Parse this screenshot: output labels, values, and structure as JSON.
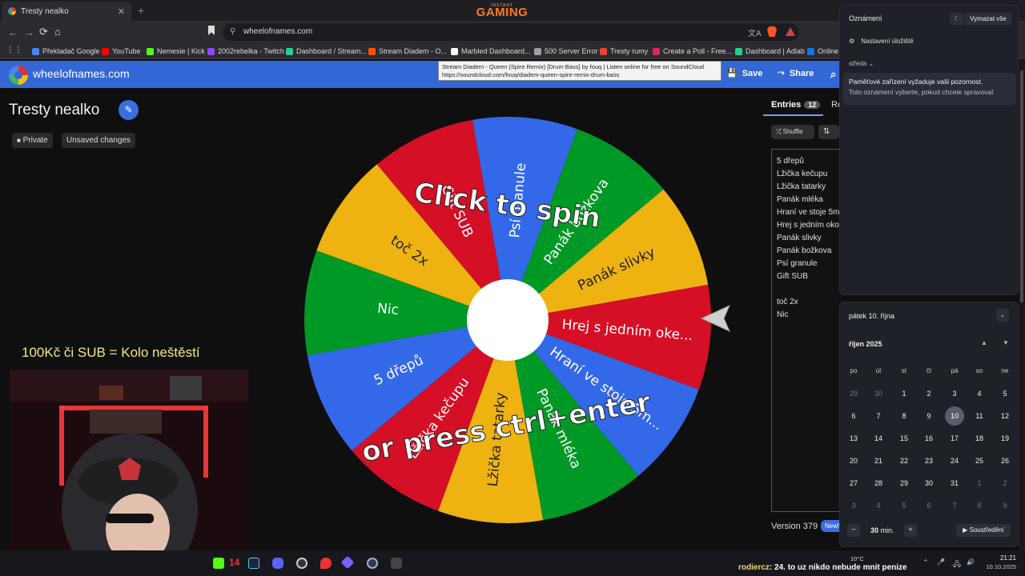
{
  "browser": {
    "active_tab": "Tresty nealko",
    "close_glyph": "✕",
    "new_tab_glyph": "+",
    "brand_small": "INSTANT",
    "brand_big": "GAMING",
    "url": "wheelofnames.com",
    "nav": {
      "back": "←",
      "forward": "→",
      "reload": "⟳",
      "home": "⌂",
      "apps": "⋮⋮"
    },
    "translate_glyph": "文A",
    "bookmarks": [
      {
        "label": "Překladač Google",
        "color": "#4285f4"
      },
      {
        "label": "YouTube",
        "color": "#ff0000"
      },
      {
        "label": "Nemesie | Kick",
        "color": "#53fc18"
      },
      {
        "label": "2002rebelka - Twitch",
        "color": "#9146ff"
      },
      {
        "label": "Dashboard / Stream...",
        "color": "#23d18b"
      },
      {
        "label": "Stream Diadem - O...",
        "color": "#ff5500"
      },
      {
        "label": "Marbled Dashboard...",
        "color": "#ffffff"
      },
      {
        "label": "500 Server Error",
        "color": "#9aa0a6"
      },
      {
        "label": "Tresty rumy",
        "color": "#ea4335"
      },
      {
        "label": "Create a Poll - Free...",
        "color": "#e0245e"
      },
      {
        "label": "Dashboard | Adlab",
        "color": "#23d18b"
      },
      {
        "label": "Online",
        "color": "#1a73e8"
      }
    ],
    "tooltip_line1": "Stream Diadem - Queen (Spire Remix) [Drum Bass] by fouq | Listen online for free on SoundCloud",
    "tooltip_line2": "https://soundcloud.com/fouq/diadem-queen-spire-remix-drum-bass"
  },
  "app": {
    "site_name": "wheelofnames.com",
    "save_label": "Save",
    "share_label": "Share",
    "save_icon": "💾",
    "share_icon": "⤳",
    "search_icon": "⌕",
    "wheel_title": "Tresty nealko",
    "edit_icon": "✎",
    "private_label": "Private",
    "lock_icon": "🔒",
    "unsaved_label": "Unsaved changes",
    "overlay_text": "100Kč či SUB = Kolo neštěstí",
    "entries_tab": "Entries",
    "entries_count": "12",
    "results_tab": "Re",
    "shuffle_label": "Shuffle",
    "shuffle_icon": "⤮",
    "sort_icon": "⇅",
    "entries": [
      "5 dřepů",
      "Lžička kečupu",
      "Lžička tatarky",
      "Panák mléka",
      "Hraní ve stoje 5m",
      "Hrej s jedním oko",
      "Panák slivky",
      "Panák božkova",
      "Psí granule",
      "Gift SUB",
      "",
      "toč 2x",
      "Nic"
    ],
    "version": "Version 379",
    "new_badge": "New!"
  },
  "wheel": {
    "spin_text_top": "Click to spin",
    "spin_text_bottom": "or press ctrl+enter",
    "segments": [
      {
        "label": "Psí granule",
        "color": "#3369e8"
      },
      {
        "label": "Panák božkova",
        "color": "#009925"
      },
      {
        "label": "Panák slivky",
        "color": "#eeb211"
      },
      {
        "label": "Hrej s jedním oke...",
        "color": "#d50f25"
      },
      {
        "label": "Hraní ve stoje 5m...",
        "color": "#3369e8"
      },
      {
        "label": "Panák mléka",
        "color": "#009925"
      },
      {
        "label": "Lžička tatarky",
        "color": "#eeb211"
      },
      {
        "label": "Lžička kečupu",
        "color": "#d50f25"
      },
      {
        "label": "5 dřepů",
        "color": "#3369e8"
      },
      {
        "label": "Nic",
        "color": "#009925"
      },
      {
        "label": "toč 2x",
        "color": "#eeb211"
      },
      {
        "label": "Gift SUB",
        "color": "#d50f25"
      }
    ]
  },
  "notifications": {
    "title": "Oznámení",
    "clear_all": "Vymazat vše",
    "settings_icon": "⚙",
    "focus_icon": "☾",
    "storage_settings": "Nastavení úložiště",
    "day": "středa",
    "chevron": "⌄",
    "message_title": "Paměťové zařízení vyžaduje vaši pozornost.",
    "message_body": "Toto oznámení vyberte, pokud chcete spravovat"
  },
  "calendar": {
    "date_label": "pátek 10. října",
    "collapse_icon": "⌄",
    "month_label": "říjen 2025",
    "up_icon": "▲",
    "down_icon": "▼",
    "weekdays": [
      "po",
      "út",
      "st",
      "čt",
      "pá",
      "so",
      "ne"
    ],
    "weeks": [
      [
        "29",
        "30",
        "1",
        "2",
        "3",
        "4",
        "5"
      ],
      [
        "6",
        "7",
        "8",
        "9",
        "10",
        "11",
        "12"
      ],
      [
        "13",
        "14",
        "15",
        "16",
        "17",
        "18",
        "19"
      ],
      [
        "20",
        "21",
        "22",
        "23",
        "24",
        "25",
        "26"
      ],
      [
        "27",
        "28",
        "29",
        "30",
        "31",
        "1",
        "2"
      ],
      [
        "3",
        "4",
        "5",
        "6",
        "7",
        "8",
        "9"
      ]
    ],
    "other_month_cells": [
      [
        0,
        0
      ],
      [
        0,
        1
      ],
      [
        4,
        5
      ],
      [
        4,
        6
      ],
      [
        5,
        0
      ],
      [
        5,
        1
      ],
      [
        5,
        2
      ],
      [
        5,
        3
      ],
      [
        5,
        4
      ],
      [
        5,
        5
      ],
      [
        5,
        6
      ]
    ],
    "today": "10",
    "focus_minus": "−",
    "focus_value": "30",
    "focus_unit": "min.",
    "focus_plus": "+",
    "focus_button": "▶ Soustředění"
  },
  "taskbar": {
    "kick_count": "14",
    "chat_user": "rodiercz",
    "chat_text": ": 24. to uz nikdo nebude mnit penize",
    "temperature": "10°C",
    "time": "21:21",
    "date": "10.10.2025",
    "tray_icons": [
      "⌃",
      "🎤",
      "🖧",
      "🔊"
    ]
  }
}
